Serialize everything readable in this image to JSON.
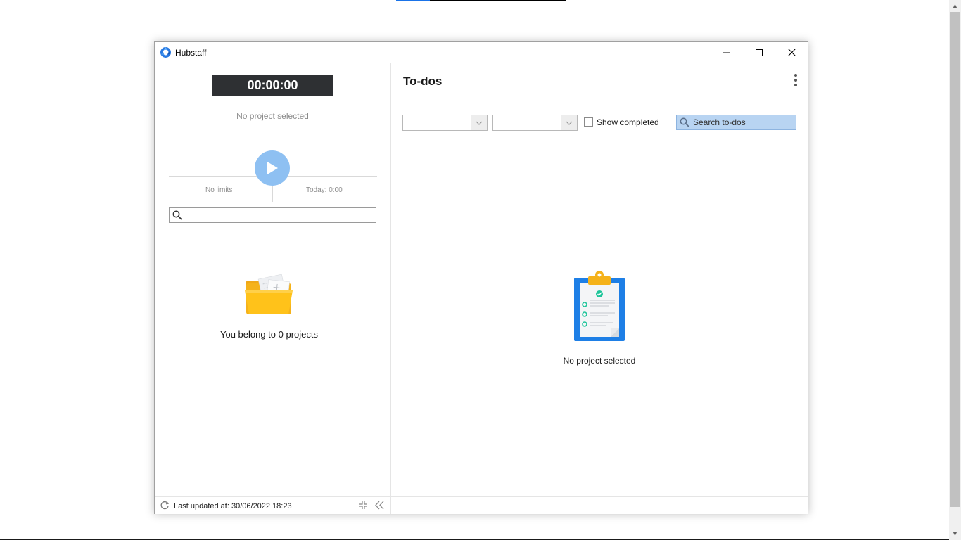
{
  "window": {
    "title": "Hubstaff"
  },
  "left": {
    "timer": "00:00:00",
    "project_label": "No project selected",
    "limits_label": "No limits",
    "today_label": "Today: 0:00",
    "search_placeholder": "",
    "projects_count": "You belong to 0 projects"
  },
  "footer": {
    "last_updated": "Last updated at: 30/06/2022 18:23"
  },
  "right": {
    "title": "To-dos",
    "select_1_value": "",
    "select_2_value": "",
    "show_completed_label": "Show completed",
    "search_placeholder": "Search to-dos",
    "empty_label": "No project selected"
  },
  "colors": {
    "timer_bg": "#2e3033",
    "play_button": "#8ec0f2",
    "search_highlight": "#b8d4f2",
    "clipboard_blue": "#1e7fe6",
    "folder_yellow": "#ffc21a"
  },
  "icons": {
    "app_logo": "hubstaff-logo-icon",
    "play": "play-icon",
    "search": "search-icon",
    "refresh": "refresh-icon",
    "shrink": "shrink-icon",
    "collapse": "double-chevron-left-icon",
    "more": "kebab-menu-icon",
    "folder": "folder-icon",
    "clipboard": "clipboard-icon"
  }
}
